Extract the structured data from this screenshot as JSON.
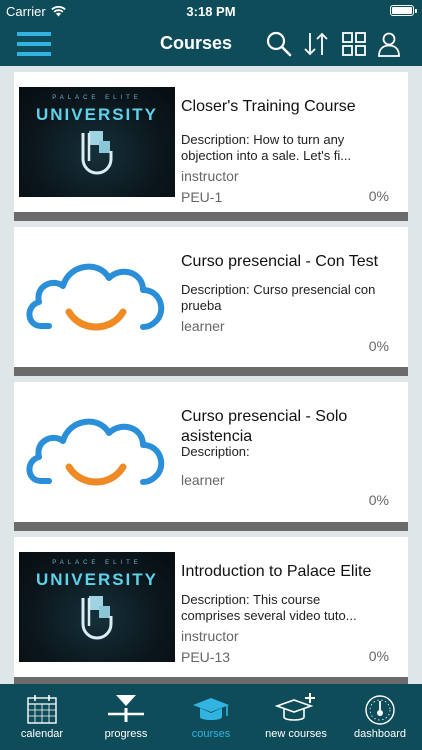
{
  "status": {
    "carrier": "Carrier",
    "time": "3:18 PM"
  },
  "header": {
    "title": "Courses"
  },
  "courses": [
    {
      "title": "Closer's Training Course",
      "description": "Description: How to turn any objection into a sale. Let's fi...",
      "role": "instructor",
      "code": "PEU-1",
      "progress": "0%",
      "thumbnail": "palace-elite-university-logo",
      "logo_line1": "PALACE ELITE",
      "logo_line2": "UNIVERSITY"
    },
    {
      "title": "Curso presencial - Con Test",
      "description": "Description: Curso presencial con prueba",
      "role": "learner",
      "code": "",
      "progress": "0%",
      "thumbnail": "cloud-smile-logo"
    },
    {
      "title": "Curso presencial - Solo asistencia",
      "description": "Description:",
      "role": "learner",
      "code": "",
      "progress": "0%",
      "thumbnail": "cloud-smile-logo"
    },
    {
      "title": "Introduction to Palace Elite",
      "description": "Description: This course comprises several video tuto...",
      "role": "instructor",
      "code": "PEU-13",
      "progress": "0%",
      "thumbnail": "palace-elite-university-logo",
      "logo_line1": "PALACE ELITE",
      "logo_line2": "UNIVERSITY"
    }
  ],
  "tabs": [
    {
      "label": "calendar",
      "icon": "calendar-icon",
      "active": false
    },
    {
      "label": "progress",
      "icon": "progress-icon",
      "active": false
    },
    {
      "label": "courses",
      "icon": "graduation-cap-icon",
      "active": true
    },
    {
      "label": "new courses",
      "icon": "graduation-cap-plus-icon",
      "active": false
    },
    {
      "label": "dashboard",
      "icon": "gauge-icon",
      "active": false
    }
  ],
  "colors": {
    "header_bg": "#0e4c5a",
    "active_tab": "#32b4e3",
    "page_bg": "#dfe6e7",
    "separator": "#6b6b6b",
    "cloud_blue": "#2a8fd8",
    "smile_orange": "#f08a24"
  }
}
